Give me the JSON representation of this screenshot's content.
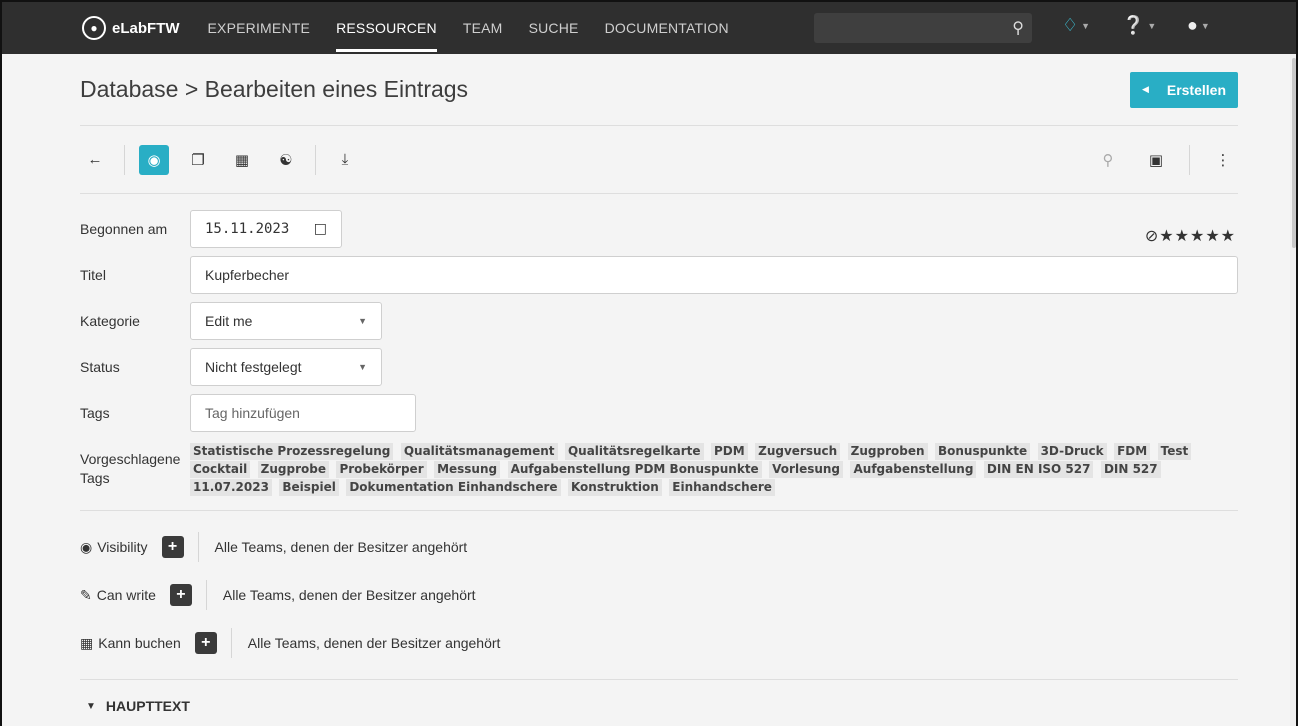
{
  "navbar": {
    "brand": "eLabFTW",
    "items": [
      "EXPERIMENTE",
      "RESSOURCEN",
      "TEAM",
      "SUCHE",
      "DOCUMENTATION"
    ],
    "active_index": 1,
    "search_placeholder": "",
    "icons": [
      "search-icon",
      "bell-icon",
      "help-icon",
      "user-icon"
    ]
  },
  "header": {
    "title": "Database > Bearbeiten eines Eintrags",
    "create_label": "Erstellen"
  },
  "toolbar": {
    "left_icons": [
      "back-arrow-icon",
      "view-eye-icon",
      "duplicate-icon",
      "calendar-icon",
      "share-icon",
      "download-icon"
    ],
    "right_icons": [
      "pin-icon",
      "lock-icon",
      "more-icon"
    ]
  },
  "form": {
    "started_label": "Begonnen am",
    "started_value": "15.11.2023",
    "title_label": "Titel",
    "title_value": "Kupferbecher",
    "category_label": "Kategorie",
    "category_value": "Edit me",
    "status_label": "Status",
    "status_value": "Nicht festgelegt",
    "tags_label": "Tags",
    "tags_placeholder": "Tag hinzufügen",
    "suggested_label": "Vorgeschlagene Tags",
    "rating": 0,
    "rating_max": 5
  },
  "suggested_tags": [
    "Statistische Prozessregelung",
    "Qualitätsmanagement",
    "Qualitätsregelkarte",
    "PDM",
    "Zugversuch",
    "Zugproben",
    "Bonuspunkte",
    "3D-Druck",
    "FDM",
    "Test",
    "Cocktail",
    "Zugprobe",
    "Probekörper",
    "Messung",
    "Aufgabenstellung PDM Bonuspunkte",
    "Vorlesung",
    "Aufgabenstellung",
    "DIN EN ISO 527",
    "DIN 527",
    "11.07.2023",
    "Beispiel",
    "Dokumentation Einhandschere",
    "Konstruktion",
    "Einhandschere"
  ],
  "permissions": [
    {
      "label": "Visibility",
      "value": "Alle Teams, denen der Besitzer angehört",
      "icon": "eye-icon"
    },
    {
      "label": "Can write",
      "value": "Alle Teams, denen der Besitzer angehört",
      "icon": "pencil-icon"
    },
    {
      "label": "Kann buchen",
      "value": "Alle Teams, denen der Besitzer angehört",
      "icon": "calendar-icon"
    }
  ],
  "section": {
    "title": "HAUPTTEXT"
  }
}
